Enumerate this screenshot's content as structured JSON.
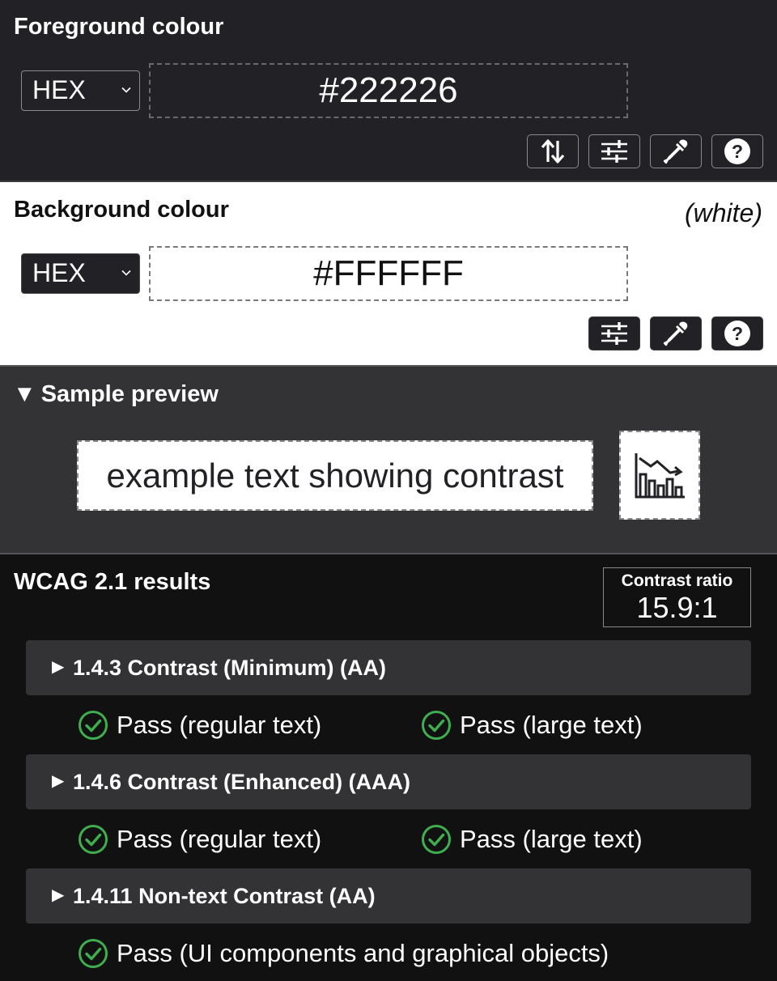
{
  "foreground": {
    "title": "Foreground colour",
    "format": "HEX",
    "value": "#222226",
    "color": "#222226"
  },
  "background": {
    "title": "Background colour",
    "colour_name": "(white)",
    "format": "HEX",
    "value": "#FFFFFF",
    "color": "#FFFFFF"
  },
  "toolbar_icons": [
    "swap-icon",
    "sliders-icon",
    "eyedropper-icon",
    "help-icon"
  ],
  "preview": {
    "title": "Sample preview",
    "sample_text": "example text showing contrast",
    "sample_icon": "chart-icon"
  },
  "results": {
    "title": "WCAG 2.1 results",
    "ratio_label": "Contrast ratio",
    "ratio_value": "15.9:1",
    "criteria": [
      {
        "label": "1.4.3 Contrast (Minimum) (AA)",
        "checks": [
          "Pass (regular text)",
          "Pass (large text)"
        ]
      },
      {
        "label": "1.4.6 Contrast (Enhanced) (AAA)",
        "checks": [
          "Pass (regular text)",
          "Pass (large text)"
        ]
      },
      {
        "label": "1.4.11 Non-text Contrast (AA)",
        "checks": [
          "Pass (UI components and graphical objects)"
        ]
      }
    ],
    "pass_color": "#3fae4f"
  }
}
